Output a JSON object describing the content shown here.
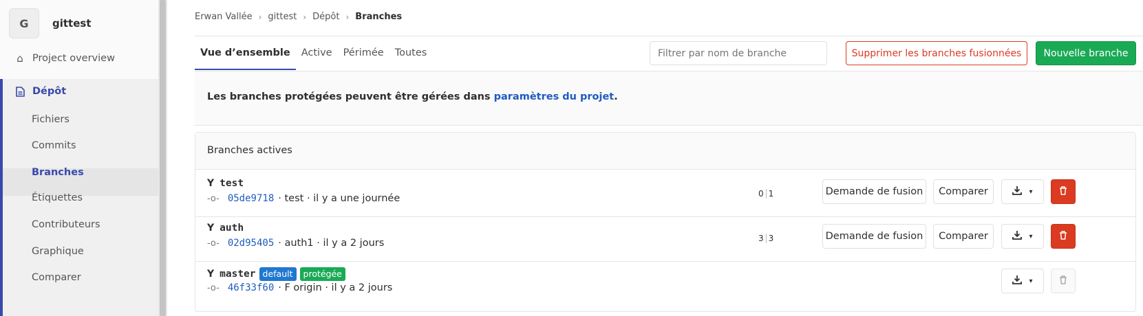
{
  "project": {
    "avatar_letter": "G",
    "name": "gittest"
  },
  "nav": {
    "overview": "Project overview",
    "repository": "Dépôt",
    "items": [
      "Fichiers",
      "Commits",
      "Branches",
      "Étiquettes",
      "Contributeurs",
      "Graphique",
      "Comparer"
    ],
    "active_item": "Branches"
  },
  "breadcrumbs": {
    "user": "Erwan Vallée",
    "project": "gittest",
    "section": "Dépôt",
    "current": "Branches"
  },
  "tabs": [
    "Vue d’ensemble",
    "Active",
    "Périmée",
    "Toutes"
  ],
  "filter": {
    "placeholder": "Filtrer par nom de branche"
  },
  "actions": {
    "delete_merged": "Supprimer les branches fusionnées",
    "new_branch": "Nouvelle branche"
  },
  "info": {
    "text": "Les branches protégées peuvent être gérées dans ",
    "link": "paramètres du projet",
    "suffix": "."
  },
  "panel_title": "Branches actives",
  "buttons": {
    "merge_request": "Demande de fusion",
    "compare": "Comparer"
  },
  "branches": [
    {
      "name": "test",
      "sha": "05de9718",
      "message": "· test · il y a une journée",
      "behind": "0",
      "ahead": "1"
    },
    {
      "name": "auth",
      "sha": "02d95405",
      "message": "· auth1 · il y a 2 jours",
      "behind": "3",
      "ahead": "3"
    },
    {
      "name": "master",
      "sha": "46f33f60",
      "message": "· F origin · il y a 2 jours",
      "badge_default": "default",
      "badge_protected": "protégée"
    }
  ],
  "colors": {
    "accent": "#3949ab",
    "danger": "#db3b21",
    "success": "#1aaa55",
    "link": "#1f5bbf"
  }
}
